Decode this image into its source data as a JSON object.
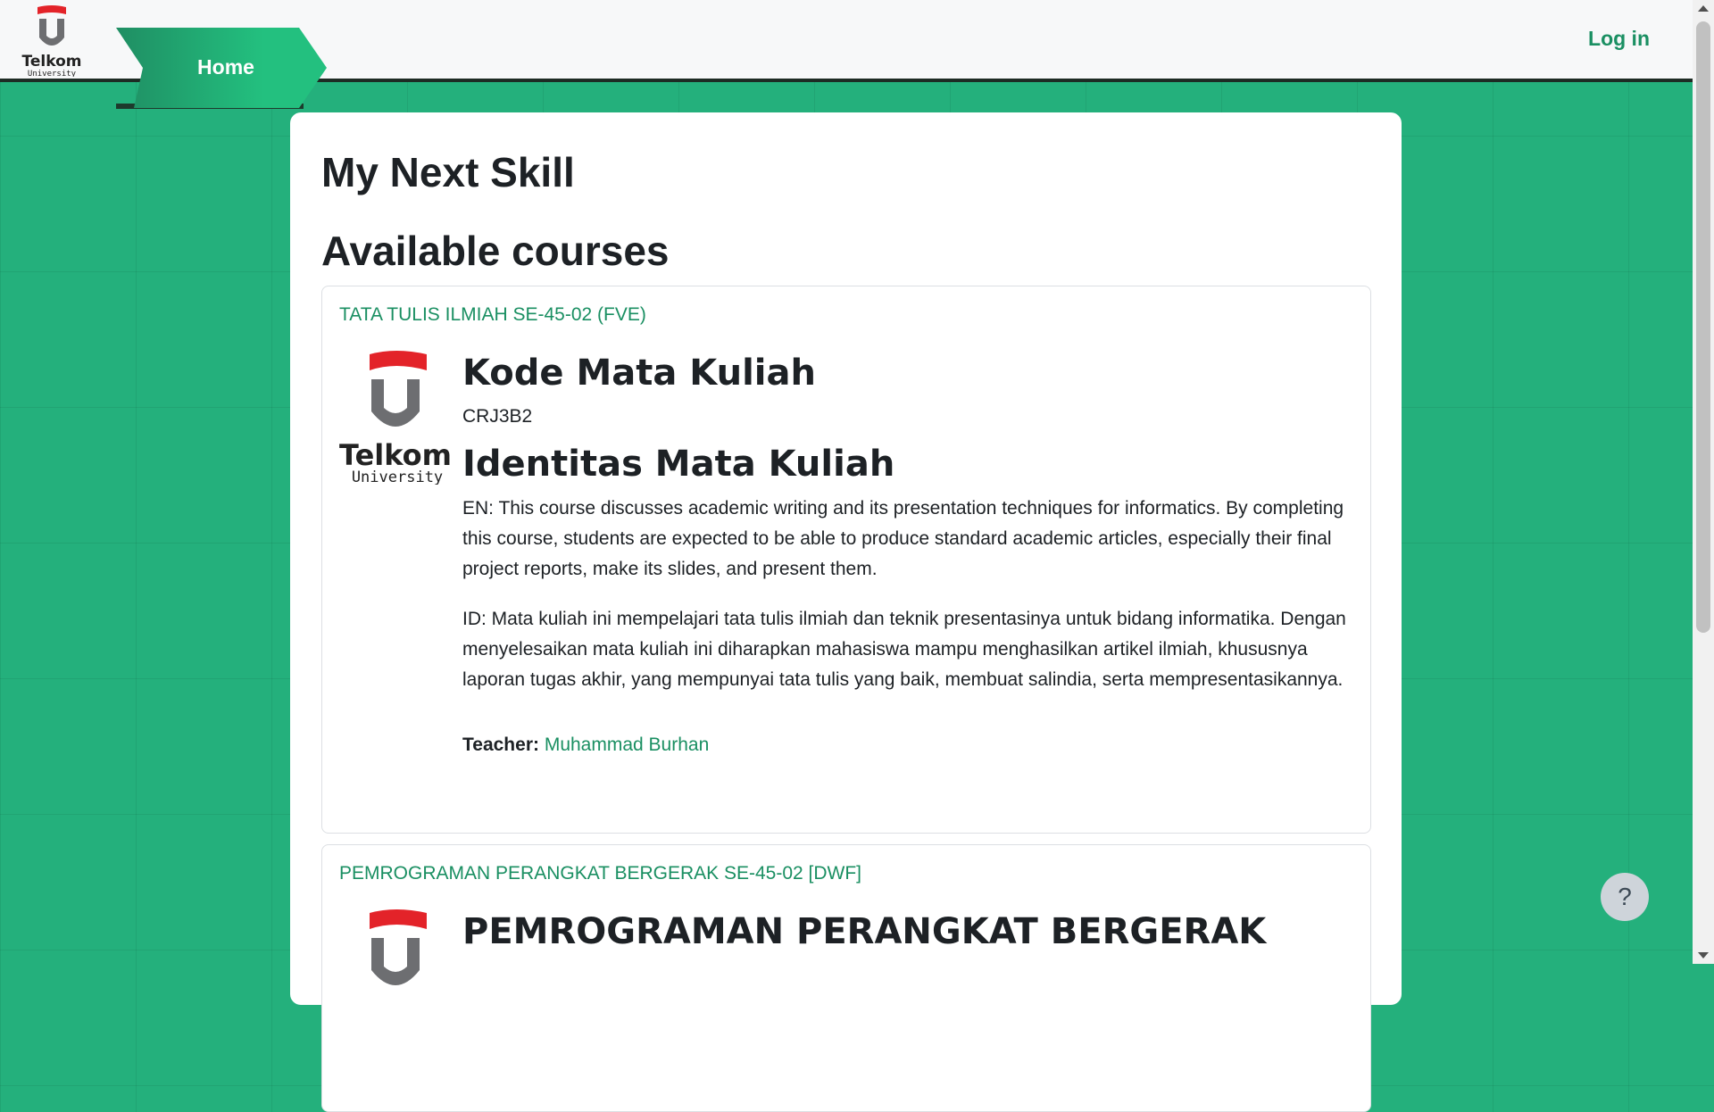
{
  "navbar": {
    "logo": {
      "wordmark": "Telkom",
      "subtitle": "University"
    },
    "home_label": "Home",
    "login_label": "Log in"
  },
  "main": {
    "site_title": "My Next Skill",
    "section_title": "Available courses",
    "courses": [
      {
        "name": "TATA TULIS ILMIAH SE-45-02 (FVE)",
        "logo": {
          "wordmark": "Telkom",
          "subtitle": "University"
        },
        "code_heading": "Kode Mata Kuliah",
        "code_value": "CRJ3B2",
        "identity_heading": "Identitas Mata Kuliah",
        "desc_en": "EN: This course discusses academic writing and its presentation techniques for informatics. By completing this course, students are expected to be able to produce  standard academic articles, especially their final project reports, make its slides, and present them.",
        "desc_id": "ID: Mata kuliah ini mempelajari tata tulis ilmiah dan teknik presentasinya untuk bidang informatika. Dengan menyelesaikan mata kuliah ini diharapkan mahasiswa mampu menghasilkan artikel ilmiah, khususnya laporan tugas  akhir, yang mempunyai tata tulis yang baik, membuat salindia, serta mempresentasikannya.",
        "teacher_label": "Teacher:",
        "teacher_name": "Muhammad Burhan"
      },
      {
        "name": "PEMROGRAMAN PERANGKAT BERGERAK SE-45-02 [DWF]",
        "heading": "PEMROGRAMAN PERANGKAT BERGERAK"
      }
    ]
  },
  "help": {
    "label": "?"
  },
  "colors": {
    "background": "#24b07c",
    "accent": "#1a8f62",
    "logo_red": "#e32329",
    "logo_gray": "#6d6e71"
  },
  "icons": [
    "telkom-logo-icon",
    "question-icon"
  ]
}
